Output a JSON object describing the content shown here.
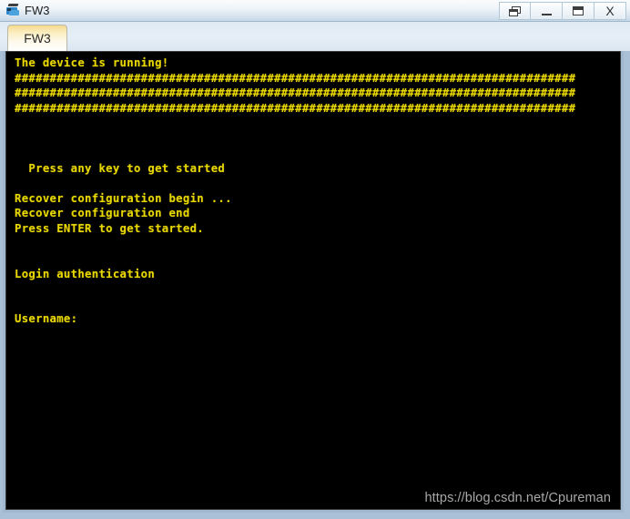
{
  "window": {
    "title": "FW3",
    "icon": "device-icon",
    "controls": [
      {
        "name": "restore-button",
        "label": "restore-icon"
      },
      {
        "name": "minimize-button",
        "label": "minimize-icon"
      },
      {
        "name": "maximize-button",
        "label": "maximize-icon"
      },
      {
        "name": "close-button",
        "label": "X"
      }
    ]
  },
  "tabs": [
    {
      "label": "FW3",
      "active": true
    }
  ],
  "terminal": {
    "foreground_color": "#e8d700",
    "background_color": "#000000",
    "hash_char": "#",
    "hash_count": 80,
    "lines": [
      {
        "type": "text",
        "text": "The device is running!"
      },
      {
        "type": "hash"
      },
      {
        "type": "hash"
      },
      {
        "type": "hash"
      },
      {
        "type": "text",
        "text": ""
      },
      {
        "type": "text",
        "text": ""
      },
      {
        "type": "text",
        "text": ""
      },
      {
        "type": "text",
        "text": "  Press any key to get started"
      },
      {
        "type": "text",
        "text": ""
      },
      {
        "type": "text",
        "text": "Recover configuration begin ..."
      },
      {
        "type": "text",
        "text": "Recover configuration end"
      },
      {
        "type": "text",
        "text": "Press ENTER to get started."
      },
      {
        "type": "text",
        "text": ""
      },
      {
        "type": "text",
        "text": ""
      },
      {
        "type": "text",
        "text": "Login authentication"
      },
      {
        "type": "text",
        "text": ""
      },
      {
        "type": "text",
        "text": ""
      },
      {
        "type": "text",
        "text": "Username:"
      }
    ]
  },
  "watermark": {
    "text": "https://blog.csdn.net/Cpureman"
  }
}
